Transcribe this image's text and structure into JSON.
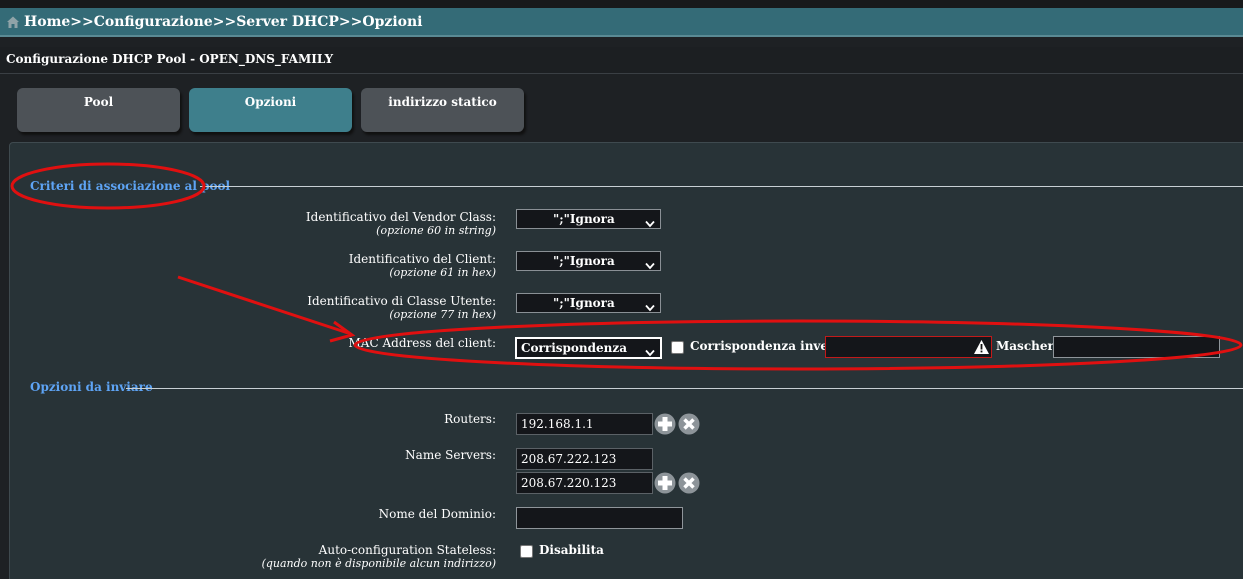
{
  "breadcrumb": {
    "home": "Home",
    "sep1": ">>",
    "config": "Configurazione",
    "sep2": ">>",
    "dhcp": "Server DHCP",
    "sep3": ">>",
    "options": "Opzioni"
  },
  "subtitle": "Configurazione DHCP Pool - OPEN_DNS_FAMILY",
  "tabs": [
    {
      "label": "Pool",
      "active": false
    },
    {
      "label": "Opzioni",
      "active": true
    },
    {
      "label": "indirizzo statico",
      "active": false
    }
  ],
  "sections": {
    "criteria": "Criteri di associazione al pool",
    "options": "Opzioni da inviare"
  },
  "criteria": {
    "vendor": {
      "label": "Identificativo del Vendor Class:",
      "sub": "(opzione 60 in string)",
      "value": "\";\"Ignora"
    },
    "client": {
      "label": "Identificativo del Client:",
      "sub": "(opzione 61 in hex)",
      "value": "\";\"Ignora"
    },
    "user_class": {
      "label": "Identificativo di Classe Utente:",
      "sub": "(opzione 77 in hex)",
      "value": "\";\"Ignora"
    },
    "mac": {
      "label": "MAC Address del client:",
      "value": "Corrispondenza",
      "inverse_label": "Corrispondenza inversa",
      "mac_value": "",
      "mask_label": "Maschera:",
      "mask_value": ""
    }
  },
  "options": {
    "routers": {
      "label": "Routers:",
      "value": "192.168.1.1"
    },
    "name_servers": {
      "label": "Name Servers:",
      "values": [
        "208.67.222.123",
        "208.67.220.123"
      ]
    },
    "domain": {
      "label": "Nome del Dominio:",
      "value": ""
    },
    "stateless": {
      "label": "Auto-configuration Stateless:",
      "sub": "(quando non è disponibile alcun indirizzo)",
      "checkbox_label": "Disabilita"
    }
  },
  "colors": {
    "header_bg": "#346b77",
    "active_tab": "#3e7f8c",
    "section_title": "#5ea4f5",
    "annotation": "#e01010"
  }
}
